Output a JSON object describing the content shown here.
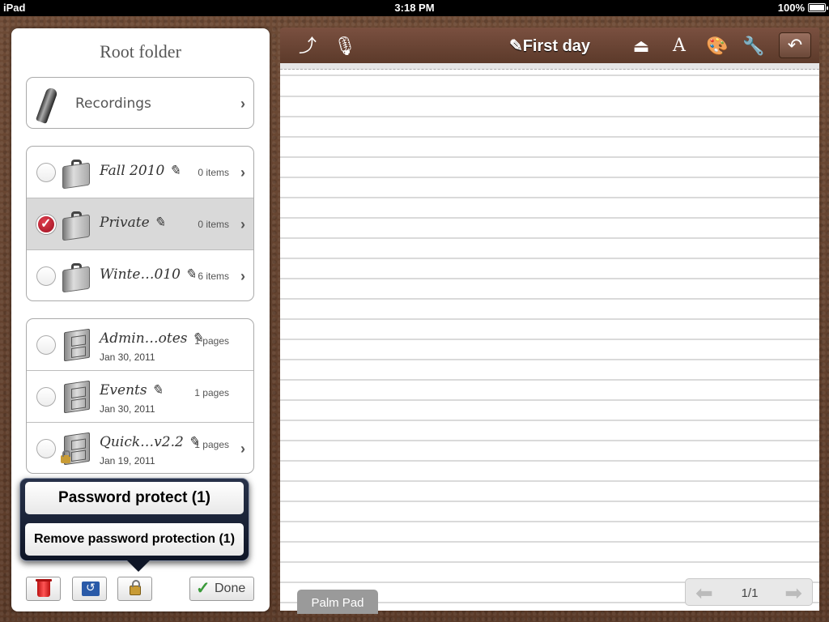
{
  "statusbar": {
    "device": "iPad",
    "time": "3:18 PM",
    "battery": "100%"
  },
  "panel": {
    "title": "Root folder",
    "recordings": {
      "label": "Recordings"
    },
    "folders": [
      {
        "name": "Fall 2010 ✎",
        "count": "0 items",
        "selected": false
      },
      {
        "name": "Private ✎",
        "count": "0 items",
        "selected": true
      },
      {
        "name": "Winte…010 ✎",
        "count": "6 items",
        "selected": false
      }
    ],
    "notebooks": [
      {
        "name": "Admin…otes ✎",
        "pages": "1 pages",
        "date": "Jan 30, 2011"
      },
      {
        "name": "Events ✎",
        "pages": "1 pages",
        "date": "Jan 30, 2011"
      },
      {
        "name": "Quick…v2.2 ✎",
        "pages": "1 pages",
        "date": "Jan 19, 2011"
      }
    ]
  },
  "popover": {
    "password_protect": "Password protect (1)",
    "remove_protection": "Remove password protection (1)"
  },
  "toolbar": {
    "done_label": "Done"
  },
  "notebook": {
    "title": "✎First day",
    "tag": "Palm Pad",
    "page_indicator": "1/1"
  }
}
